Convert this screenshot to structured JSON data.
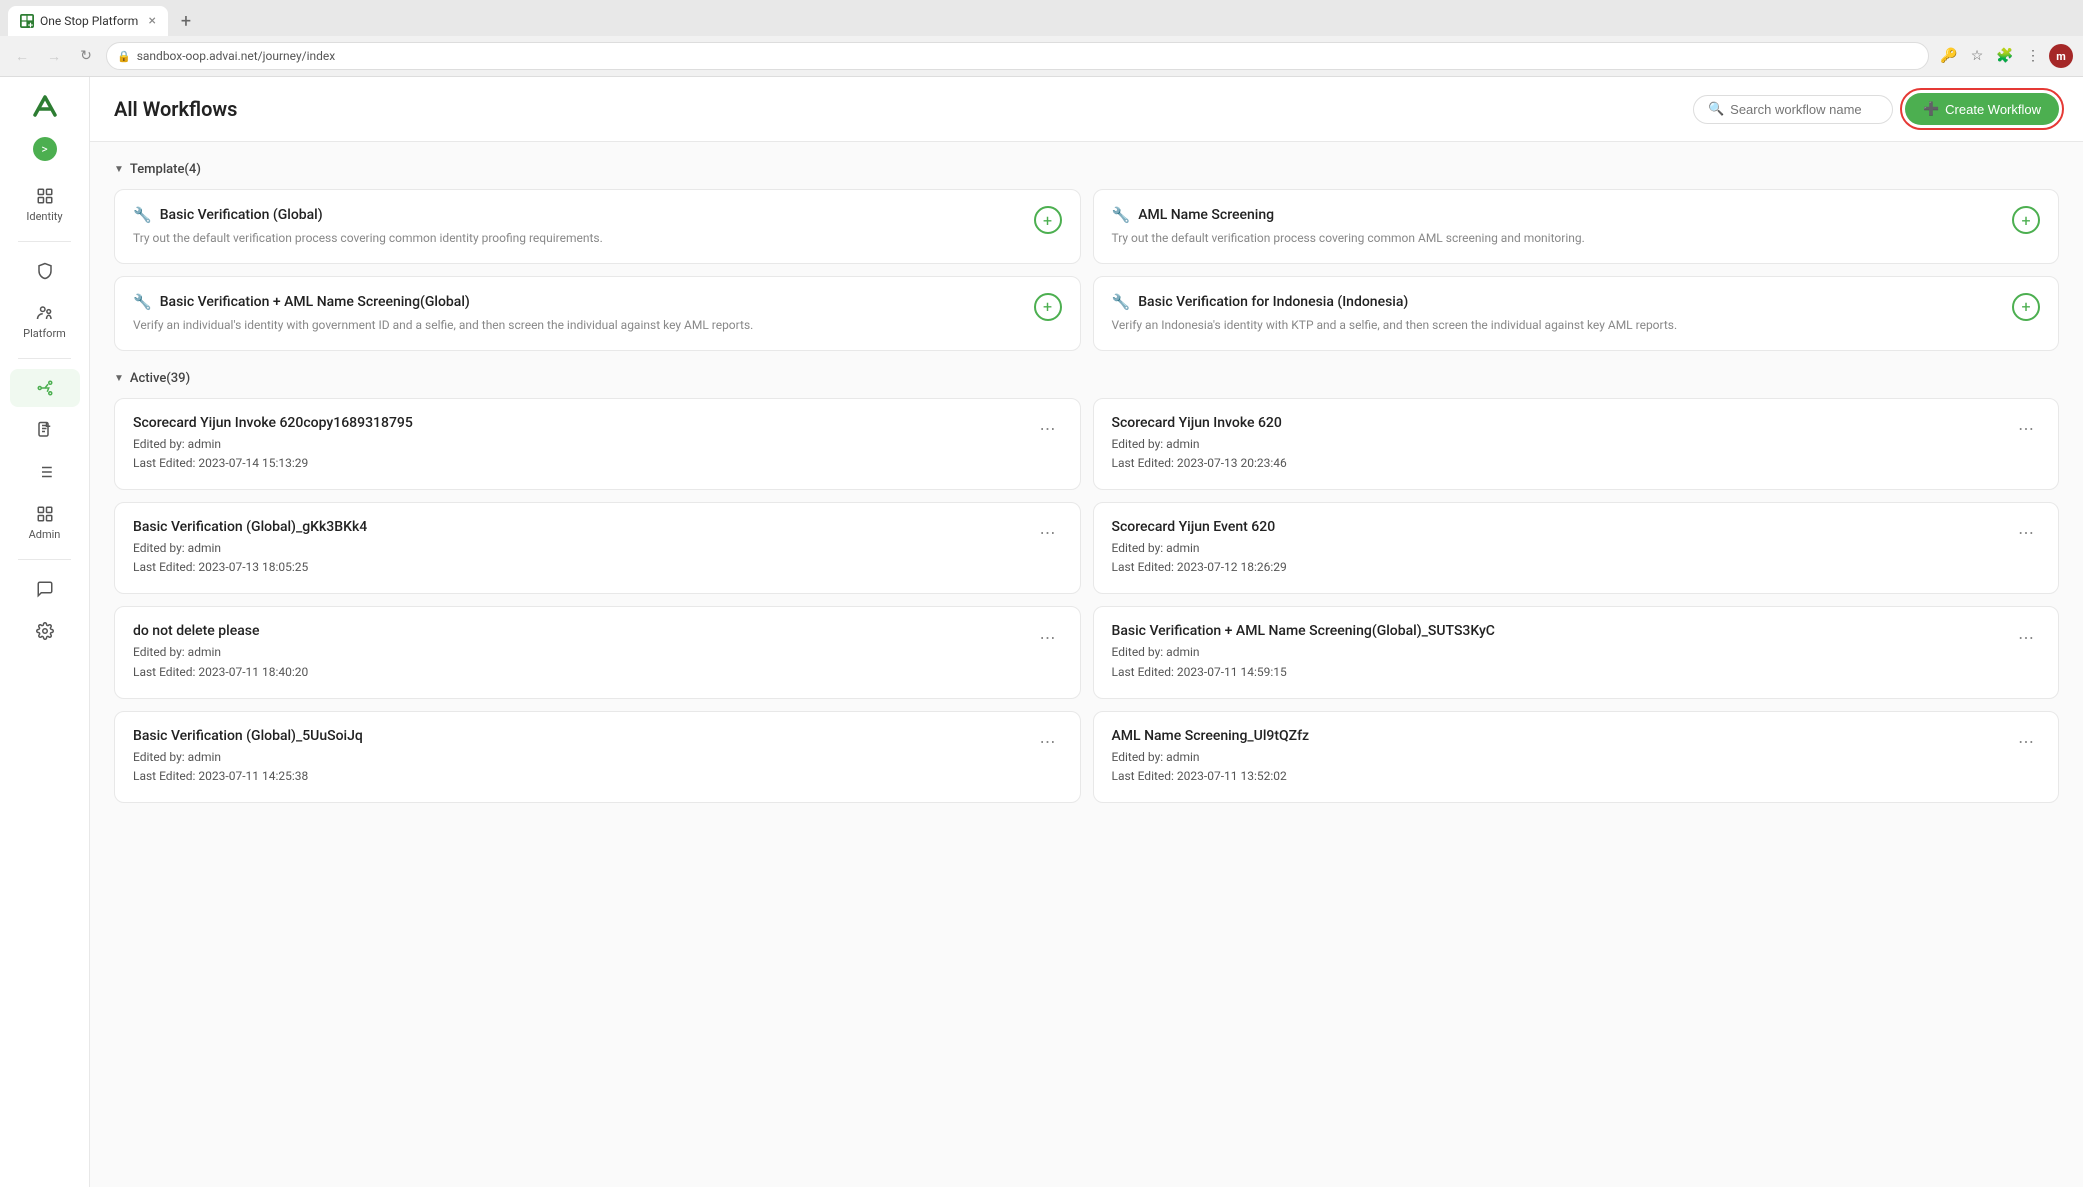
{
  "browser": {
    "tab_title": "One Stop Platform",
    "tab_favicon": "∧∧",
    "address": "sandbox-oop.advai.net/journey/index",
    "close_symbol": "×",
    "new_tab_symbol": "+",
    "avatar_initials": "m"
  },
  "header": {
    "title": "All Workflows",
    "search_placeholder": "Search workflow name",
    "create_button_label": "Create Workflow"
  },
  "sidebar": {
    "logo_text": "∧∧",
    "toggle_symbol": ">",
    "sections": [
      {
        "items": [
          {
            "label": "Identity",
            "icon": "grid"
          }
        ]
      },
      {
        "items": [
          {
            "label": "Platform",
            "icon": "shield"
          },
          {
            "label": "",
            "icon": "people"
          }
        ]
      },
      {
        "items": [
          {
            "label": "",
            "icon": "flow"
          },
          {
            "label": "",
            "icon": "doc"
          },
          {
            "label": "",
            "icon": "list"
          },
          {
            "label": "",
            "icon": "apps"
          },
          {
            "label": "Admin",
            "icon": ""
          }
        ]
      },
      {
        "items": [
          {
            "label": "",
            "icon": "chat"
          },
          {
            "label": "",
            "icon": "gear"
          }
        ]
      }
    ]
  },
  "templates_section": {
    "label": "Template(4)",
    "cards": [
      {
        "title": "Basic Verification (Global)",
        "desc": "Try out the default verification process covering common identity proofing requirements.",
        "icon": "🔧"
      },
      {
        "title": "AML Name Screening",
        "desc": "Try out the default verification process covering common AML screening and monitoring.",
        "icon": "🔧"
      },
      {
        "title": "Basic Verification + AML Name Screening(Global)",
        "desc": "Verify an individual's identity with government ID and a selfie, and then screen the individual against key AML reports.",
        "icon": "🔧"
      },
      {
        "title": "Basic Verification for Indonesia (Indonesia)",
        "desc": "Verify an Indonesia's identity with KTP and a selfie, and then screen the individual against key AML reports.",
        "icon": "🔧"
      }
    ]
  },
  "active_section": {
    "label": "Active(39)",
    "cards": [
      {
        "name": "Scorecard Yijun Invoke 620copy1689318795",
        "edited_by": "admin",
        "last_edited": "2023-07-14 15:13:29"
      },
      {
        "name": "Scorecard Yijun Invoke 620",
        "edited_by": "admin",
        "last_edited": "2023-07-13 20:23:46"
      },
      {
        "name": "Basic Verification (Global)_gKk3BKk4",
        "edited_by": "admin",
        "last_edited": "2023-07-13 18:05:25"
      },
      {
        "name": "Scorecard Yijun Event 620",
        "edited_by": "admin",
        "last_edited": "2023-07-12 18:26:29"
      },
      {
        "name": "do not delete please",
        "edited_by": "admin",
        "last_edited": "2023-07-11 18:40:20"
      },
      {
        "name": "Basic Verification + AML Name Screening(Global)_SUTS3KyC",
        "edited_by": "admin",
        "last_edited": "2023-07-11 14:59:15"
      },
      {
        "name": "Basic Verification (Global)_5UuSoiJq",
        "edited_by": "admin",
        "last_edited": "2023-07-11 14:25:38"
      },
      {
        "name": "AML Name Screening_Ul9tQZfz",
        "edited_by": "admin",
        "last_edited": "2023-07-11 13:52:02"
      }
    ]
  },
  "labels": {
    "edited_by": "Edited by: ",
    "last_edited": "Last Edited: "
  }
}
